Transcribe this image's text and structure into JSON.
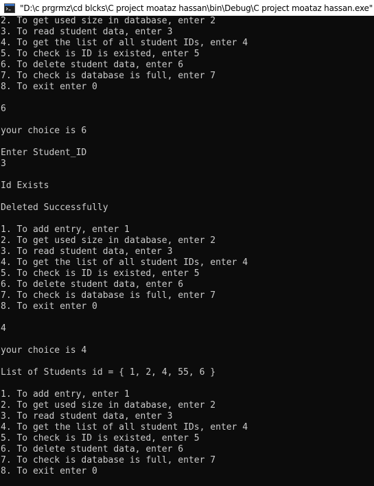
{
  "window": {
    "title": "\"D:\\c prgrmz\\cd blcks\\C project moataz hassan\\bin\\Debug\\C project moataz hassan.exe\""
  },
  "console": {
    "lines": [
      "2. To get used size in database, enter 2",
      "3. To read student data, enter 3",
      "4. To get the list of all student IDs, enter 4",
      "5. To check is ID is existed, enter 5",
      "6. To delete student data, enter 6",
      "7. To check is database is full, enter 7",
      "8. To exit enter 0",
      "",
      "6",
      "",
      "your choice is 6",
      "",
      "Enter Student_ID",
      "3",
      "",
      "Id Exists",
      "",
      "Deleted Successfully",
      "",
      "1. To add entry, enter 1",
      "2. To get used size in database, enter 2",
      "3. To read student data, enter 3",
      "4. To get the list of all student IDs, enter 4",
      "5. To check is ID is existed, enter 5",
      "6. To delete student data, enter 6",
      "7. To check is database is full, enter 7",
      "8. To exit enter 0",
      "",
      "4",
      "",
      "your choice is 4",
      "",
      "List of Students id = { 1, 2, 4, 55, 6 }",
      "",
      "1. To add entry, enter 1",
      "2. To get used size in database, enter 2",
      "3. To read student data, enter 3",
      "4. To get the list of all student IDs, enter 4",
      "5. To check is ID is existed, enter 5",
      "6. To delete student data, enter 6",
      "7. To check is database is full, enter 7",
      "8. To exit enter 0"
    ]
  },
  "colors": {
    "console_background": "#0c0c0c",
    "console_text": "#cccccc",
    "titlebar_background": "#ffffff"
  },
  "icons": {
    "app": "console-app-icon"
  }
}
